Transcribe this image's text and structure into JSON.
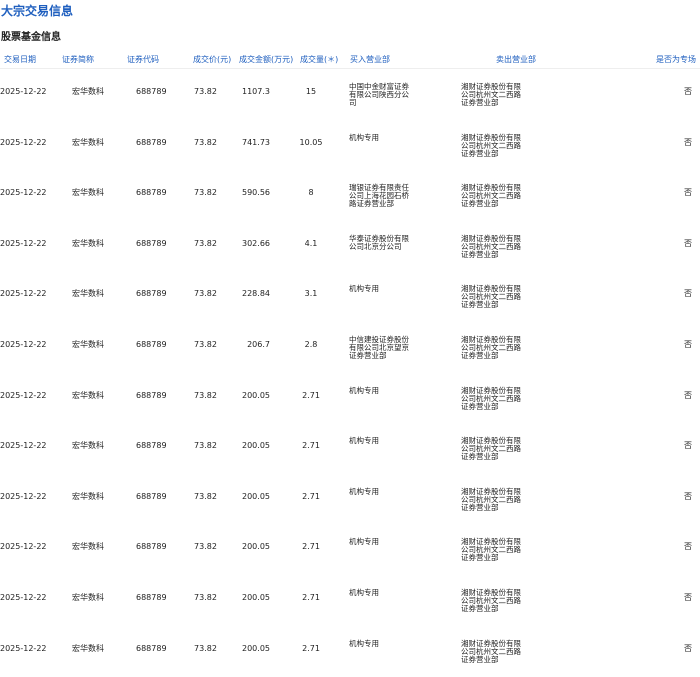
{
  "page_title": "大宗交易信息",
  "section_title": "股票基金信息",
  "columns": {
    "date": "交易日期",
    "name": "证券简称",
    "code": "证券代码",
    "price": "成交价(元)",
    "amount": "成交金额(万元)",
    "volume": "成交量(＊)",
    "buyer": "买入营业部",
    "seller": "卖出营业部",
    "flag": "是否为专场"
  },
  "rows": [
    {
      "date": "2025-12-22",
      "name": "宏华数科",
      "code": "688789",
      "price": "73.82",
      "amount": "1107.3",
      "volume": "15",
      "buyer": "中国中金财富证券有限公司陕西分公司",
      "seller": "湘财证券股份有限公司杭州文二西路证券营业部",
      "flag": "否"
    },
    {
      "date": "2025-12-22",
      "name": "宏华数科",
      "code": "688789",
      "price": "73.82",
      "amount": "741.73",
      "volume": "10.05",
      "buyer": "机构专用",
      "seller": "湘财证券股份有限公司杭州文二西路证券营业部",
      "flag": "否"
    },
    {
      "date": "2025-12-22",
      "name": "宏华数科",
      "code": "688789",
      "price": "73.82",
      "amount": "590.56",
      "volume": "8",
      "buyer": "瑞银证券有限责任公司上海花园石桥路证券营业部",
      "seller": "湘财证券股份有限公司杭州文二西路证券营业部",
      "flag": "否"
    },
    {
      "date": "2025-12-22",
      "name": "宏华数科",
      "code": "688789",
      "price": "73.82",
      "amount": "302.66",
      "volume": "4.1",
      "buyer": "华泰证券股份有限公司北京分公司",
      "seller": "湘财证券股份有限公司杭州文二西路证券营业部",
      "flag": "否"
    },
    {
      "date": "2025-12-22",
      "name": "宏华数科",
      "code": "688789",
      "price": "73.82",
      "amount": "228.84",
      "volume": "3.1",
      "buyer": "机构专用",
      "seller": "湘财证券股份有限公司杭州文二西路证券营业部",
      "flag": "否"
    },
    {
      "date": "2025-12-22",
      "name": "宏华数科",
      "code": "688789",
      "price": "73.82",
      "amount": "206.7",
      "volume": "2.8",
      "buyer": "中信建投证券股份有限公司北京望京证券营业部",
      "seller": "湘财证券股份有限公司杭州文二西路证券营业部",
      "flag": "否"
    },
    {
      "date": "2025-12-22",
      "name": "宏华数科",
      "code": "688789",
      "price": "73.82",
      "amount": "200.05",
      "volume": "2.71",
      "buyer": "机构专用",
      "seller": "湘财证券股份有限公司杭州文二西路证券营业部",
      "flag": "否"
    },
    {
      "date": "2025-12-22",
      "name": "宏华数科",
      "code": "688789",
      "price": "73.82",
      "amount": "200.05",
      "volume": "2.71",
      "buyer": "机构专用",
      "seller": "湘财证券股份有限公司杭州文二西路证券营业部",
      "flag": "否"
    },
    {
      "date": "2025-12-22",
      "name": "宏华数科",
      "code": "688789",
      "price": "73.82",
      "amount": "200.05",
      "volume": "2.71",
      "buyer": "机构专用",
      "seller": "湘财证券股份有限公司杭州文二西路证券营业部",
      "flag": "否"
    },
    {
      "date": "2025-12-22",
      "name": "宏华数科",
      "code": "688789",
      "price": "73.82",
      "amount": "200.05",
      "volume": "2.71",
      "buyer": "机构专用",
      "seller": "湘财证券股份有限公司杭州文二西路证券营业部",
      "flag": "否"
    },
    {
      "date": "2025-12-22",
      "name": "宏华数科",
      "code": "688789",
      "price": "73.82",
      "amount": "200.05",
      "volume": "2.71",
      "buyer": "机构专用",
      "seller": "湘财证券股份有限公司杭州文二西路证券营业部",
      "flag": "否"
    },
    {
      "date": "2025-12-22",
      "name": "宏华数科",
      "code": "688789",
      "price": "73.82",
      "amount": "200.05",
      "volume": "2.71",
      "buyer": "机构专用",
      "seller": "湘财证券股份有限公司杭州文二西路证券营业部",
      "flag": "否"
    }
  ]
}
